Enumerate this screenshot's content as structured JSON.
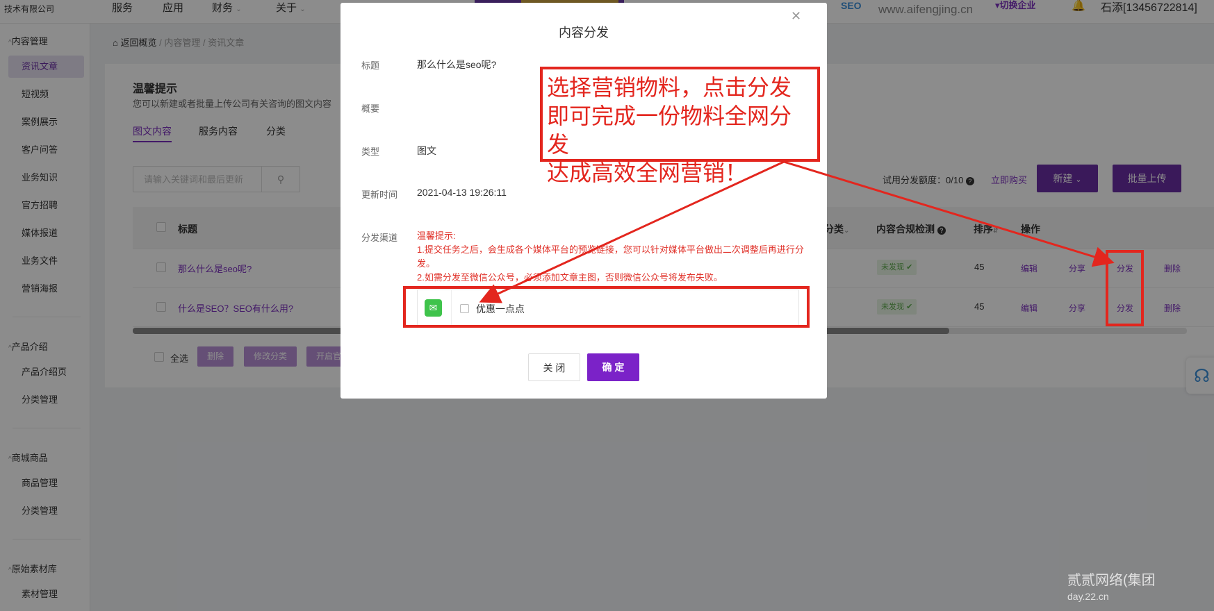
{
  "topbar": {
    "company": "技术有限公司",
    "nav": [
      "服务",
      "应用",
      "财务",
      "关于"
    ],
    "site_url": "www.aifengjing.cn",
    "switch_enterprise": "▾切换企业",
    "user": "石添[13456722814]"
  },
  "sidebar": {
    "sections": [
      {
        "title": "内容管理",
        "items": [
          "资讯文章",
          "短视频",
          "案例展示",
          "客户问答",
          "业务知识",
          "官方招聘",
          "媒体报道",
          "业务文件",
          "营销海报"
        ]
      },
      {
        "title": "产品介绍",
        "items": [
          "产品介绍页",
          "分类管理"
        ]
      },
      {
        "title": "商城商品",
        "items": [
          "商品管理",
          "分类管理"
        ]
      },
      {
        "title": "原始素材库",
        "items": [
          "素材管理"
        ]
      }
    ]
  },
  "breadcrumb": [
    "返回概览",
    "内容管理",
    "资讯文章"
  ],
  "main": {
    "tip_title": "温馨提示",
    "tip_desc": "您可以新建或者批量上传公司有关咨询的图文内容",
    "tabs": [
      "图文内容",
      "服务内容",
      "分类"
    ],
    "search_placeholder": "请输入关键词和最后更新",
    "quota": "试用分发额度：0/10",
    "buy_link": "立即购买",
    "new_button": "新建",
    "batch_upload": "批量上传",
    "columns": [
      "标题",
      "分类",
      "内容合规检测",
      "排序",
      "操作"
    ],
    "rows": [
      {
        "title": "那么什么是seo呢?",
        "status": "未发现",
        "sort": "45"
      },
      {
        "title": "什么是SEO？SEO有什么用?",
        "status": "未发现",
        "sort": "45"
      }
    ],
    "row_actions": [
      "编辑",
      "分享",
      "分发",
      "删除"
    ],
    "select_all": "全选",
    "bottom_buttons": [
      "删除",
      "修改分类",
      "开启官"
    ]
  },
  "modal": {
    "title": "内容分发",
    "fields": {
      "title_label": "标题",
      "title_value": "那么什么是seo呢?",
      "summary_label": "概要",
      "type_label": "类型",
      "type_value": "图文",
      "update_label": "更新时间",
      "update_value": "2021-04-13 19:26:11",
      "channel_label": "分发渠道"
    },
    "tip_heading": "温馨提示:",
    "tip_line1": "1.提交任务之后，会生成各个媒体平台的预览链接，您可以针对媒体平台做出二次调整后再进行分发。",
    "tip_line2": "2.如需分发至微信公众号，必须添加文章主图，否则微信公众号将发布失败。",
    "channel_name": "优惠一点点",
    "cancel": "关 闭",
    "confirm": "确 定"
  },
  "annotation": {
    "line1": "选择营销物料，点击分发",
    "line2": "即可完成一份物料全网分发",
    "line3": "达成高效全网营销！",
    "color": "#e3261e"
  },
  "watermark": {
    "line1": "贰贰网络(集团",
    "line2": "day.22.cn"
  }
}
